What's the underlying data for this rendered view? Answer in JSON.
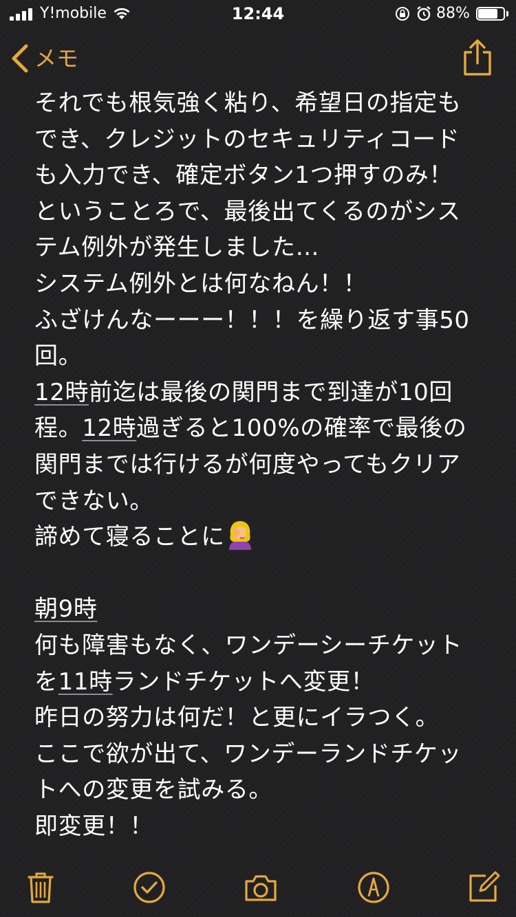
{
  "status_bar": {
    "carrier": "Y!mobile",
    "time": "12:44",
    "battery_percent": "88%",
    "battery_level": 0.88
  },
  "nav": {
    "back_label": "メモ"
  },
  "note": {
    "lines": [
      [
        {
          "t": "それでも根気強く粘り、希望日の指定も"
        }
      ],
      [
        {
          "t": "でき、クレジットのセキュリティコード"
        }
      ],
      [
        {
          "t": "も入力でき、確定ボタン1つ押すのみ！"
        }
      ],
      [
        {
          "t": "ということろで、最後出てくるのがシス"
        }
      ],
      [
        {
          "t": "テム例外が発生しました…"
        }
      ],
      [
        {
          "t": "システム例外とは何なねん！！"
        }
      ],
      [
        {
          "t": "ふざけんなーーー！！！を繰り返す事50"
        }
      ],
      [
        {
          "t": "回。"
        }
      ],
      [
        {
          "t": "12時",
          "u": true
        },
        {
          "t": "前迄は最後の関門まで到達が10回"
        }
      ],
      [
        {
          "t": "程。"
        },
        {
          "t": "12時",
          "u": true
        },
        {
          "t": "過ぎると100%の確率で最後の"
        }
      ],
      [
        {
          "t": "関門までは行けるが何度やってもクリア"
        }
      ],
      [
        {
          "t": "できない。"
        }
      ],
      [
        {
          "t": "諦めて寝ることに"
        },
        {
          "emoji": "face-palm-icon"
        }
      ],
      [],
      [
        {
          "t": "朝9時",
          "u": true
        }
      ],
      [
        {
          "t": "何も障害もなく、ワンデーシーチケット"
        }
      ],
      [
        {
          "t": "を"
        },
        {
          "t": "11時",
          "u": true
        },
        {
          "t": "ランドチケットへ変更！"
        }
      ],
      [
        {
          "t": "昨日の努力は何だ！と更にイラつく。"
        }
      ],
      [
        {
          "t": "ここで欲が出て、ワンデーランドチケッ"
        }
      ],
      [
        {
          "t": "トへの変更を試みる。"
        }
      ],
      [
        {
          "t": "即変更！！"
        }
      ]
    ]
  },
  "toolbar": {
    "icons": [
      "trash-icon",
      "checklist-icon",
      "camera-icon",
      "markup-icon",
      "compose-icon"
    ]
  },
  "colors": {
    "accent": "#e5a93a",
    "background": "#1f1f21",
    "text": "#ffffff",
    "underline": "#8e8e93"
  }
}
